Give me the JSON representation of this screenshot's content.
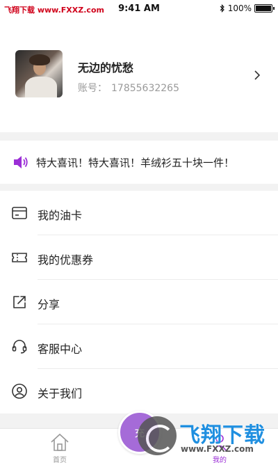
{
  "status_bar": {
    "watermark": "飞翔下载 www.FXXZ.com",
    "time": "9:41 AM",
    "battery": "100%"
  },
  "profile": {
    "name": "无边的忧愁",
    "account_label": "账号：",
    "account_value": "17855632265"
  },
  "notice": {
    "text": "特大喜讯！特大喜讯！羊绒衫五十块一件！"
  },
  "menu": {
    "items": [
      {
        "label": "我的油卡",
        "icon": "card-icon"
      },
      {
        "label": "我的优惠券",
        "icon": "coupon-icon"
      },
      {
        "label": "分享",
        "icon": "share-icon"
      },
      {
        "label": "客服中心",
        "icon": "headset-icon"
      },
      {
        "label": "关于我们",
        "icon": "user-circle-icon"
      }
    ]
  },
  "tabbar": {
    "home_label": "首页",
    "fab_label": "充",
    "mine_label": "我的"
  },
  "watermark": {
    "title": "飞翔下载",
    "url": "www.FXXZ.com"
  },
  "colors": {
    "accent": "#9b2ed6",
    "fab": "#a56bd8",
    "background": "#f2f2f2"
  }
}
